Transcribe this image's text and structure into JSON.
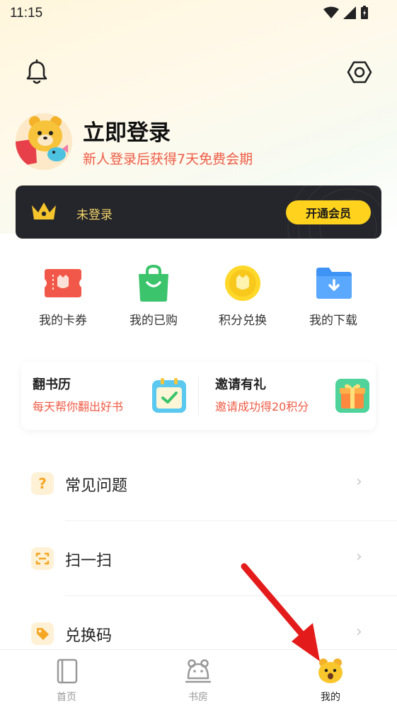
{
  "status_bar": {
    "time": "11:15"
  },
  "profile": {
    "login_title": "立即登录",
    "login_subtitle": "新人登录后获得7天免费会期"
  },
  "vip": {
    "status_label": "未登录",
    "open_button": "开通会员",
    "accent_color": "#ffd21d"
  },
  "quick_actions": [
    {
      "label": "我的卡券",
      "icon": "coupon-icon"
    },
    {
      "label": "我的已购",
      "icon": "shopping-bag-icon"
    },
    {
      "label": "积分兑换",
      "icon": "coin-icon"
    },
    {
      "label": "我的下载",
      "icon": "download-folder-icon"
    }
  ],
  "promos": [
    {
      "title": "翻书历",
      "subtitle": "每天帮你翻出好书",
      "icon": "calendar-icon"
    },
    {
      "title": "邀请有礼",
      "subtitle": "邀请成功得20积分",
      "icon": "gift-icon"
    }
  ],
  "menu": [
    {
      "label": "常见问题",
      "icon": "question-icon"
    },
    {
      "label": "扫一扫",
      "icon": "scan-icon"
    },
    {
      "label": "兑换码",
      "icon": "tag-icon"
    }
  ],
  "tabs": [
    {
      "label": "首页",
      "icon": "book-icon",
      "active": false
    },
    {
      "label": "书房",
      "icon": "bear-outline-icon",
      "active": false
    },
    {
      "label": "我的",
      "icon": "bear-face-icon",
      "active": true
    }
  ]
}
